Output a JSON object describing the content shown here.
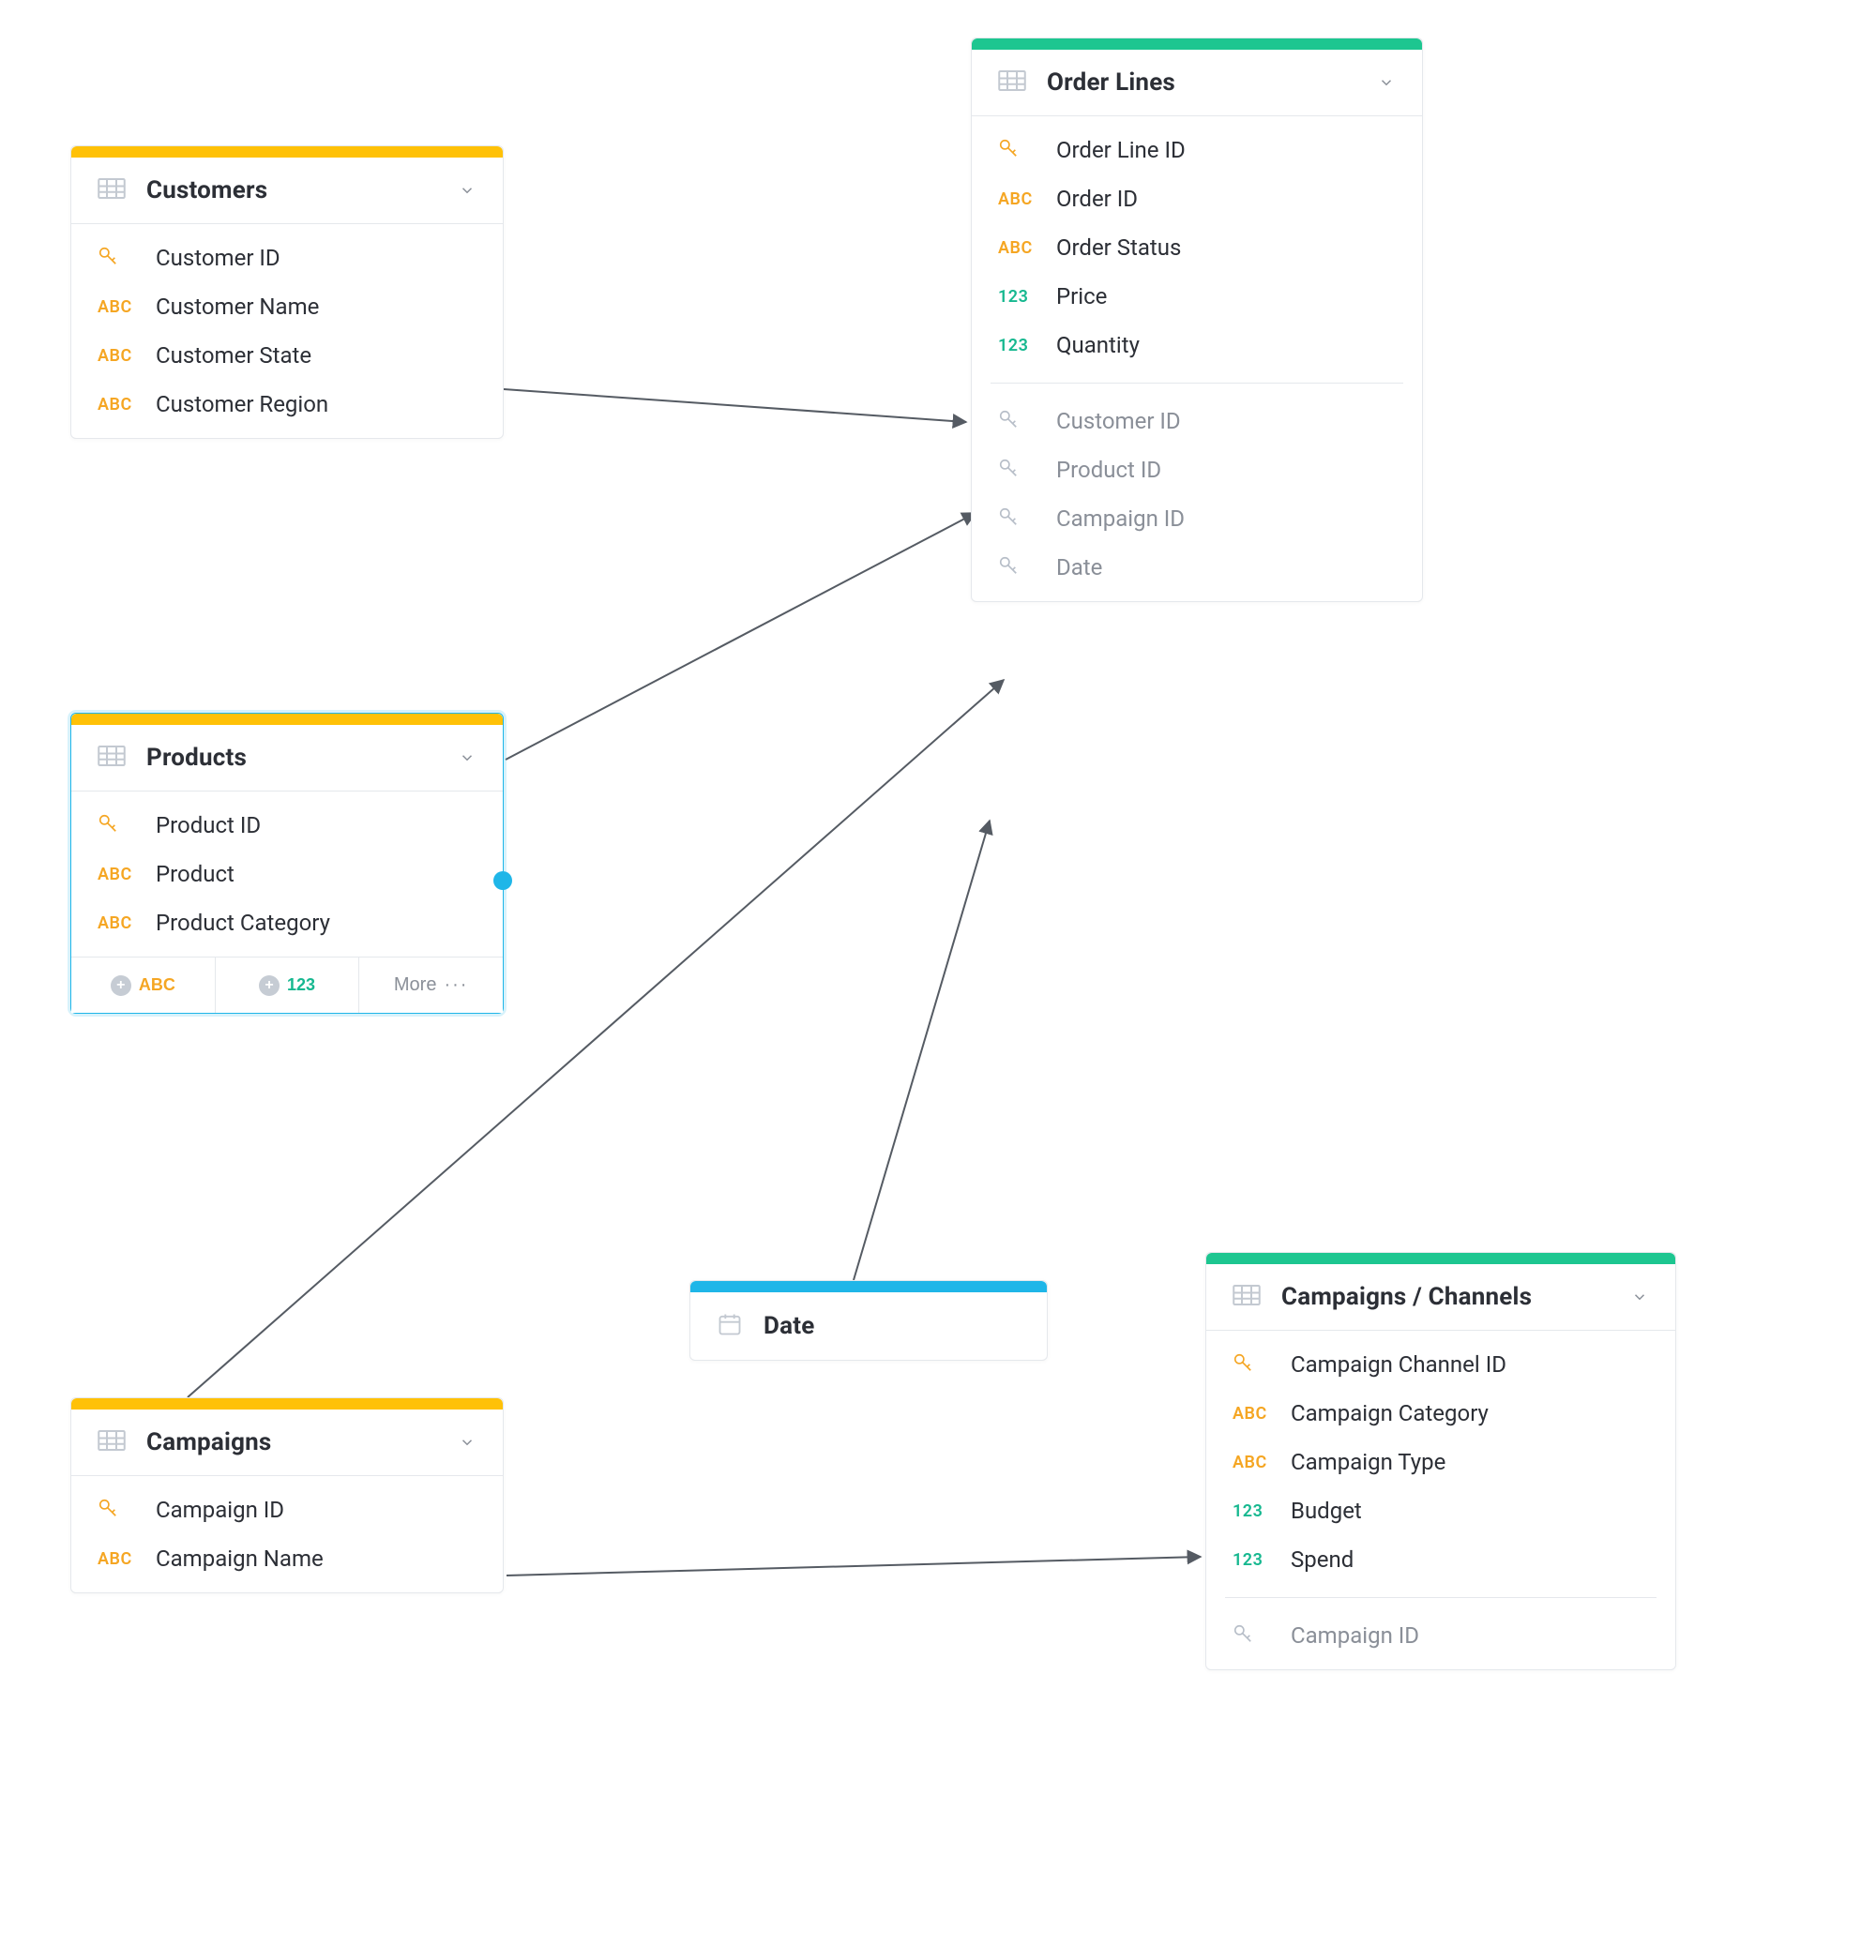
{
  "palette": {
    "yellow": "#ffc107",
    "green": "#1dc690",
    "blue": "#1fb6e8",
    "orange": "#f5a623",
    "teal": "#17b890"
  },
  "nodes": {
    "customers": {
      "title": "Customers",
      "accent": "yellow",
      "sections": [
        [
          {
            "type": "key",
            "label": "Customer ID"
          },
          {
            "type": "abc",
            "label": "Customer Name"
          },
          {
            "type": "abc",
            "label": "Customer State"
          },
          {
            "type": "abc",
            "label": "Customer Region"
          }
        ]
      ]
    },
    "products": {
      "title": "Products",
      "accent": "yellow",
      "selected": true,
      "sections": [
        [
          {
            "type": "key",
            "label": "Product ID"
          },
          {
            "type": "abc",
            "label": "Product"
          },
          {
            "type": "abc",
            "label": "Product Category"
          }
        ]
      ],
      "footer": {
        "add_abc": "ABC",
        "add_num": "123",
        "more": "More"
      }
    },
    "campaigns": {
      "title": "Campaigns",
      "accent": "yellow",
      "sections": [
        [
          {
            "type": "key",
            "label": "Campaign ID"
          },
          {
            "type": "abc",
            "label": "Campaign Name"
          }
        ]
      ]
    },
    "order_lines": {
      "title": "Order Lines",
      "accent": "green",
      "sections": [
        [
          {
            "type": "key",
            "label": "Order Line ID"
          },
          {
            "type": "abc",
            "label": "Order ID"
          },
          {
            "type": "abc",
            "label": "Order Status"
          },
          {
            "type": "num",
            "label": "Price"
          },
          {
            "type": "num",
            "label": "Quantity"
          }
        ],
        [
          {
            "type": "fk",
            "label": "Customer ID"
          },
          {
            "type": "fk",
            "label": "Product ID"
          },
          {
            "type": "fk",
            "label": "Campaign ID"
          },
          {
            "type": "fk",
            "label": "Date"
          }
        ]
      ]
    },
    "campaigns_channels": {
      "title": "Campaigns / Channels",
      "accent": "green",
      "sections": [
        [
          {
            "type": "key",
            "label": "Campaign Channel ID"
          },
          {
            "type": "abc",
            "label": "Campaign Category"
          },
          {
            "type": "abc",
            "label": "Campaign Type"
          },
          {
            "type": "num",
            "label": "Budget"
          },
          {
            "type": "num",
            "label": "Spend"
          }
        ],
        [
          {
            "type": "fk",
            "label": "Campaign ID"
          }
        ]
      ]
    },
    "date": {
      "title": "Date",
      "accent": "blue",
      "isDate": true
    }
  },
  "connections": [
    {
      "from": "customers",
      "to": "order_lines"
    },
    {
      "from": "products",
      "to": "order_lines"
    },
    {
      "from": "campaigns",
      "to": "order_lines"
    },
    {
      "from": "date",
      "to": "order_lines"
    },
    {
      "from": "campaigns",
      "to": "campaigns_channels"
    }
  ]
}
